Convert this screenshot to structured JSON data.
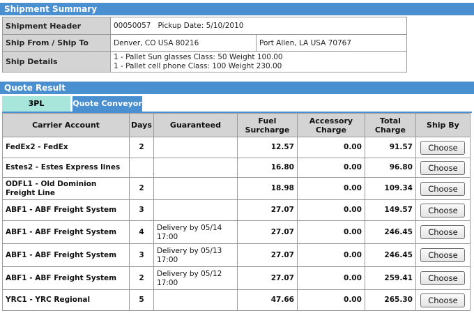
{
  "summary": {
    "title": "Shipment Summary",
    "header_label": "Shipment Header",
    "header_value": "00050057   Pickup Date: 5/10/2010",
    "shipfromto_label": "Ship From / Ship To",
    "ship_from": "Denver, CO USA 80216",
    "ship_to": "Port Allen, LA USA 70767",
    "details_label": "Ship Details",
    "details": [
      "1 - Pallet Sun glasses Class: 50 Weight 100.00",
      "1 - Pallet cell phone Class: 100 Weight 230.00"
    ]
  },
  "quote": {
    "title": "Quote Result",
    "tabs": [
      "3PL",
      "Quote Conveyor"
    ],
    "columns": [
      "Carrier Account",
      "Days",
      "Guaranteed",
      "Fuel Surcharge",
      "Accessory Charge",
      "Total Charge",
      "Ship By"
    ],
    "rows": [
      {
        "carrier": "FedEx2 - FedEx",
        "days": "2",
        "guaranteed": "",
        "fuel": "12.57",
        "accessory": "0.00",
        "total": "91.57",
        "action": "Choose"
      },
      {
        "carrier": "Estes2 - Estes Express lines",
        "days": "",
        "guaranteed": "",
        "fuel": "16.80",
        "accessory": "0.00",
        "total": "96.80",
        "action": "Choose"
      },
      {
        "carrier": "ODFL1 - Old Dominion Freight Line",
        "days": "2",
        "guaranteed": "",
        "fuel": "18.98",
        "accessory": "0.00",
        "total": "109.34",
        "action": "Choose"
      },
      {
        "carrier": "ABF1 - ABF Freight System",
        "days": "3",
        "guaranteed": "",
        "fuel": "27.07",
        "accessory": "0.00",
        "total": "149.57",
        "action": "Choose"
      },
      {
        "carrier": "ABF1 - ABF Freight System",
        "days": "4",
        "guaranteed": "Delivery by 05/14 17:00",
        "fuel": "27.07",
        "accessory": "0.00",
        "total": "246.45",
        "action": "Choose"
      },
      {
        "carrier": "ABF1 - ABF Freight System",
        "days": "3",
        "guaranteed": "Delivery by 05/13 17:00",
        "fuel": "27.07",
        "accessory": "0.00",
        "total": "246.45",
        "action": "Choose"
      },
      {
        "carrier": "ABF1 - ABF Freight System",
        "days": "2",
        "guaranteed": "Delivery by 05/12 17:00",
        "fuel": "27.07",
        "accessory": "0.00",
        "total": "259.41",
        "action": "Choose"
      },
      {
        "carrier": "YRC1 - YRC Regional",
        "days": "5",
        "guaranteed": "",
        "fuel": "47.66",
        "accessory": "0.00",
        "total": "265.30",
        "action": "Choose"
      }
    ]
  },
  "colors": {
    "header_bar": "#4a8fd0",
    "tab_inactive": "#a8e6dc",
    "label_bg": "#d4d4d4"
  }
}
